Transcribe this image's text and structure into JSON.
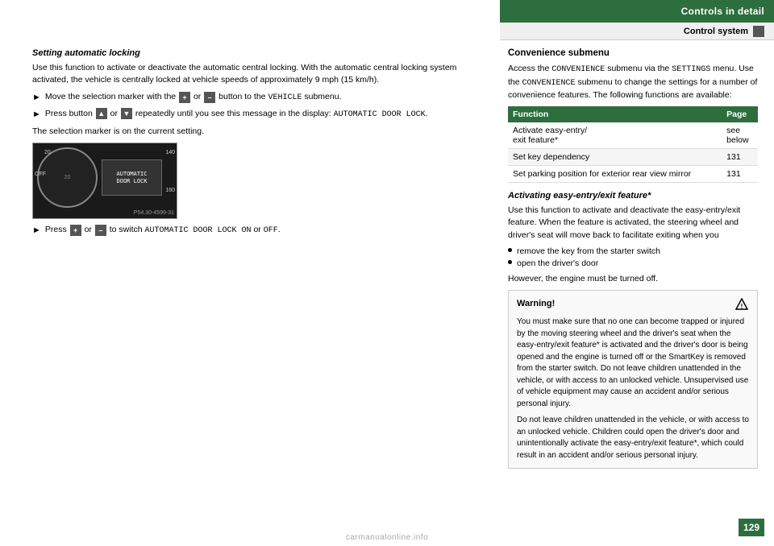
{
  "header": {
    "title": "Controls in detail",
    "subtitle": "Control system"
  },
  "page_number": "129",
  "left_column": {
    "section1": {
      "heading": "Setting automatic locking",
      "intro": "Use this function to activate or deactivate the automatic central locking. With the automatic central locking system activated, the vehicle is centrally locked at vehicle speeds of approximately 9 mph (15 km/h).",
      "bullets": [
        {
          "text_parts": [
            "Move the selection marker with the ",
            "+",
            " or ",
            "–",
            " button to the ",
            "VEHICLE",
            " submenu."
          ]
        },
        {
          "text_parts": [
            "Press button ",
            "▲",
            " or ",
            "▼",
            " repeatedly until you see this message in the display: ",
            "AUTOMATIC DOOR LOCK",
            "."
          ]
        }
      ],
      "note": "The selection marker is on the current setting.",
      "dashboard_text": [
        "AUTOMATIC",
        "DOOR LOCK"
      ],
      "dashboard_caption": "P54.30-4599-31",
      "final_bullet": {
        "text_parts": [
          "Press ",
          "+",
          " or ",
          "–",
          " to switch ",
          "AUTOMATIC DOOR LOCK ON",
          " or ",
          "OFF",
          "."
        ]
      }
    }
  },
  "right_column_top": {
    "heading": "Convenience submenu",
    "intro": "Access the CONVENIENCE submenu via the SETTINGS menu. Use the CONVENIENCE submenu to change the settings for a number of convenience features. The following functions are available:",
    "table": {
      "headers": [
        "Function",
        "Page"
      ],
      "rows": [
        {
          "function": "Activate easy-entry/exit feature*",
          "page": "see below"
        },
        {
          "function": "Set key dependency",
          "page": "131"
        },
        {
          "function": "Set parking position for exterior rear view mirror",
          "page": "131"
        }
      ]
    },
    "act_heading": "Activating easy-entry/exit feature*",
    "act_intro": "Use this function to activate and deactivate the easy-entry/exit feature. When the feature is activated, the steering wheel and driver's seat will move back to facilitate exiting when you",
    "act_bullets": [
      "remove the key from the starter switch",
      "open the driver's door"
    ],
    "act_note": "However, the engine must be turned off."
  },
  "right_column_warning": {
    "title": "Warning!",
    "paragraphs": [
      "You must make sure that no one can become trapped or injured by the moving steering wheel and the driver's seat when the easy-entry/exit feature* is activated and the driver's door is being opened and the engine is turned off or the SmartKey is removed from the starter switch. Do not leave children unattended in the vehicle, or with access to an unlocked vehicle. Unsupervised use of vehicle equipment may cause an accident and/or serious personal injury.",
      "Do not leave children unattended in the vehicle, or with access to an unlocked vehicle. Children could open the driver's door and unintentionally activate the easy-entry/exit feature*, which could result in an accident and/or serious personal injury."
    ]
  },
  "watermark": "carmanualonline.info"
}
